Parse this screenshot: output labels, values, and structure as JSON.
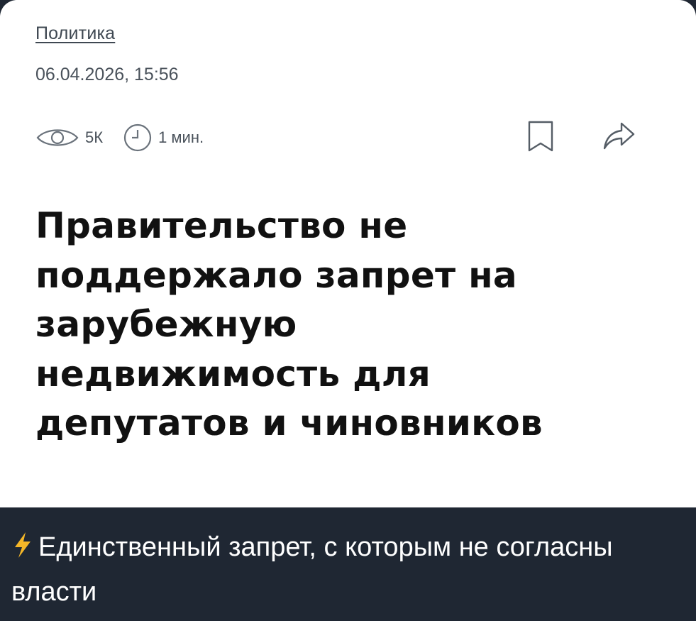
{
  "article": {
    "category": "Политика",
    "datetime": "06.04.2026, 15:56",
    "views": "5К",
    "read_time": "1 мин.",
    "headline_lines": [
      "Правительство не",
      "поддержало запрет на",
      "зарубежную",
      "недвижимость для",
      "депутатов и чиновников"
    ]
  },
  "caption": {
    "emoji": "⚡",
    "text": "Единственный запрет, с которым не согласны власти"
  },
  "icons": {
    "views": "eye-icon",
    "time": "clock-icon",
    "bookmark": "bookmark-icon",
    "share": "share-icon",
    "emoji": "lightning-icon"
  },
  "colors": {
    "background": "#1f2733",
    "card": "#ffffff",
    "text": "#111111",
    "meta": "#4a525b",
    "bolt": "#f5b728"
  }
}
